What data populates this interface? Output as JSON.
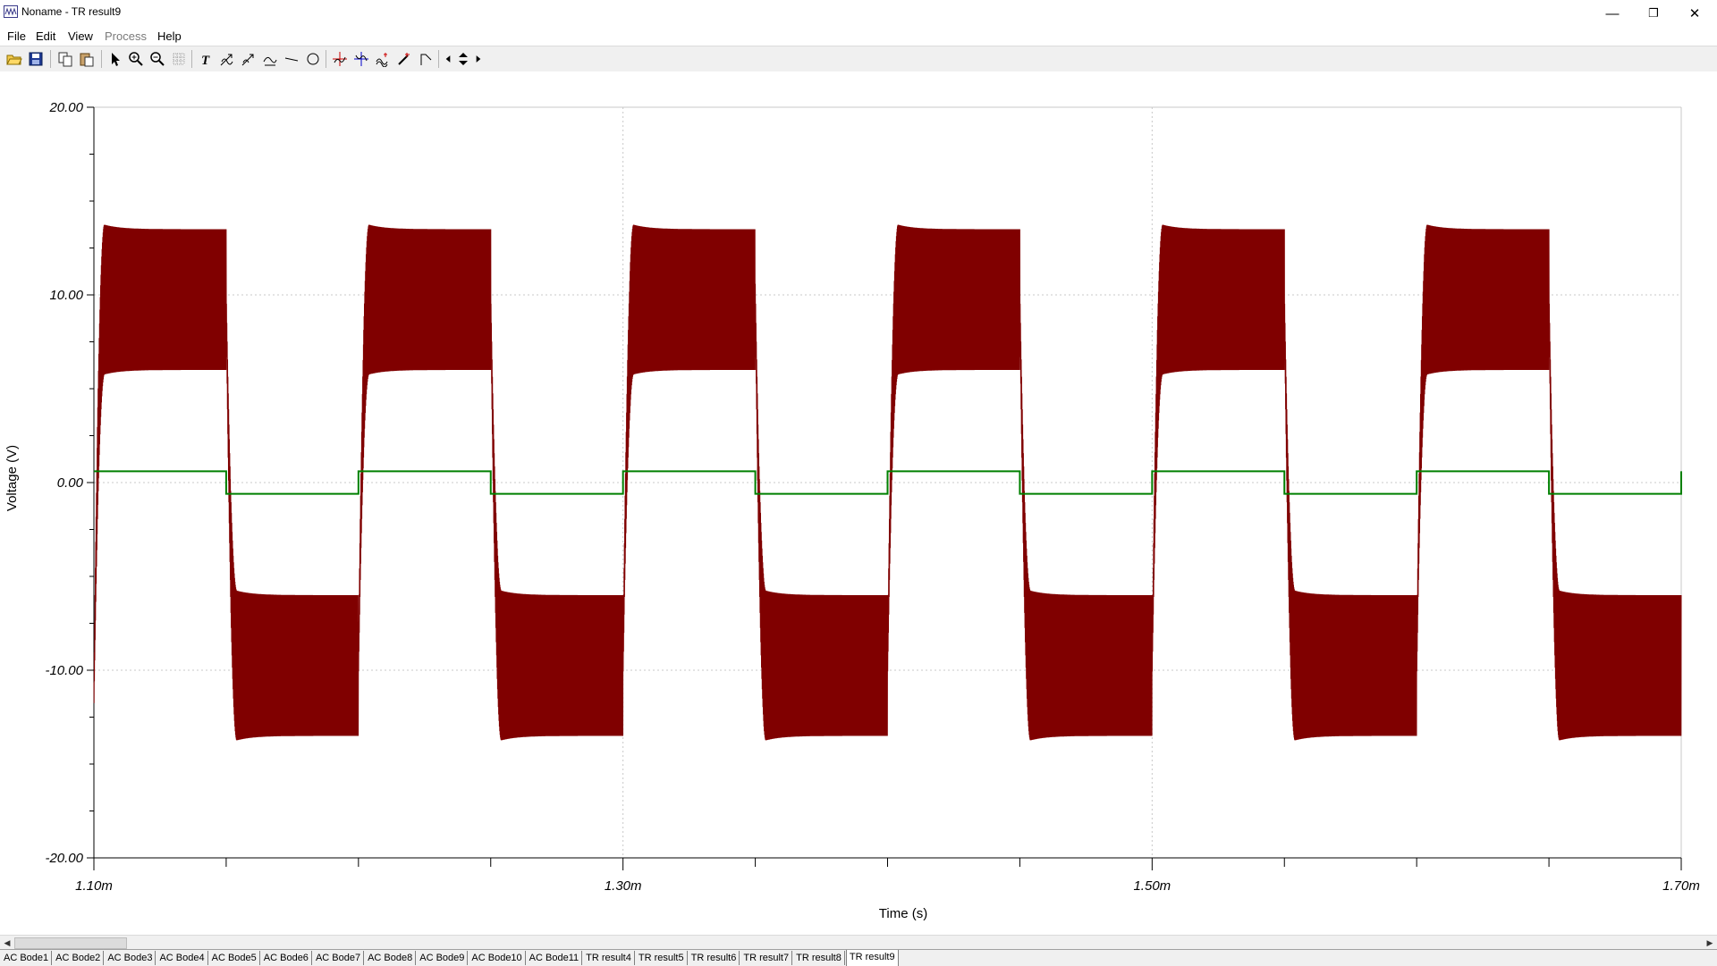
{
  "window": {
    "title": "Noname - TR result9",
    "controls": {
      "minimize": "—",
      "maximize": "❐",
      "close": "✕"
    }
  },
  "menu": [
    {
      "label": "File",
      "enabled": true
    },
    {
      "label": "Edit",
      "enabled": true
    },
    {
      "label": "View",
      "enabled": true
    },
    {
      "label": "Process",
      "enabled": false
    },
    {
      "label": "Help",
      "enabled": true
    }
  ],
  "toolbar": {
    "icons": [
      "open-folder-icon",
      "save-icon",
      "copy-icon",
      "paste-icon",
      "pointer-icon",
      "zoom-in-icon",
      "zoom-out-icon",
      "grid-icon",
      "text-icon",
      "cursor-a-icon",
      "cursor-b-icon",
      "cursor-c-icon",
      "line-icon",
      "circle-icon",
      "cross-cursor-icon",
      "cross-cursor-2-icon",
      "wave-icon",
      "probe-icon",
      "corner-icon",
      "left-arrow-icon",
      "up-down-arrow-icon",
      "right-arrow-icon"
    ]
  },
  "chart_data": {
    "type": "line",
    "xlabel": "Time (s)",
    "ylabel": "Voltage (V)",
    "xlim": [
      0.0011,
      0.0017
    ],
    "ylim": [
      -20,
      20
    ],
    "x_tick_labels": [
      "1.10m",
      "1.30m",
      "1.50m",
      "1.70m"
    ],
    "y_tick_labels": [
      "20.00",
      "10.00",
      "0.00",
      "-10.00",
      "-20.00"
    ],
    "grid": true,
    "series": [
      {
        "color": "#800000",
        "kind": "oscillating square wave",
        "period_s": 0.0001,
        "first_rise_s": 0.0011,
        "high_band": [
          6,
          13.5
        ],
        "low_band": [
          -13.5,
          -6
        ],
        "initial_value": -11.5
      },
      {
        "color": "#008000",
        "kind": "square wave",
        "period_s": 0.0001,
        "first_rise_s": 0.0011,
        "high": 0.6,
        "low": -0.6
      }
    ]
  },
  "tabs": [
    "AC Bode1",
    "AC Bode2",
    "AC Bode3",
    "AC Bode4",
    "AC Bode5",
    "AC Bode6",
    "AC Bode7",
    "AC Bode8",
    "AC Bode9",
    "AC Bode10",
    "AC Bode11",
    "TR result4",
    "TR result5",
    "TR result6",
    "TR result7",
    "TR result8",
    "TR result9"
  ],
  "active_tab": "TR result9"
}
